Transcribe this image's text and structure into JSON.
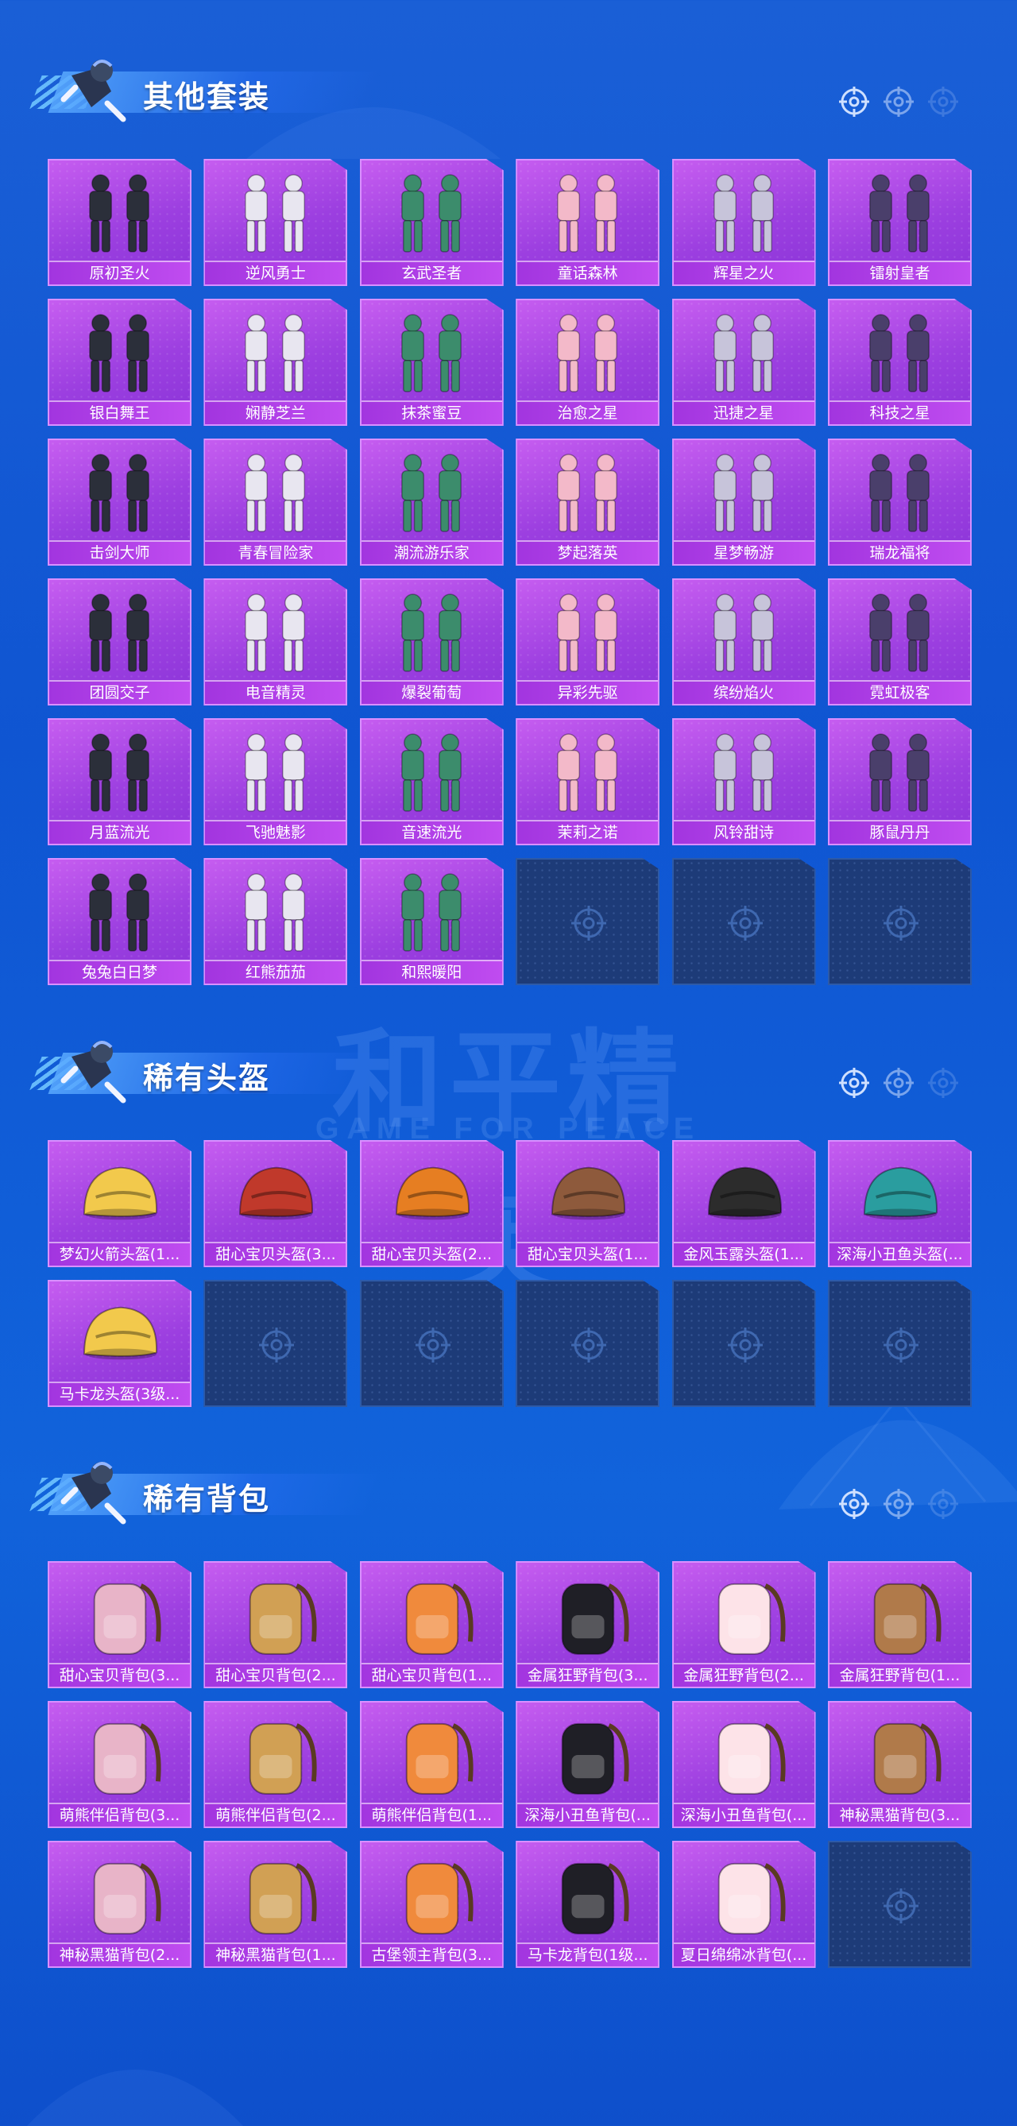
{
  "colors": {
    "background": "#1160d8",
    "card": "#a640e6",
    "label": "#b046ec",
    "empty": "#1d3b78"
  },
  "watermark": {
    "main": "和平精英",
    "sub": "GAME FOR PEACE"
  },
  "sections": [
    {
      "title": "其他套装",
      "icon": "outfit-icon",
      "items": [
        "原初圣火",
        "逆风勇士",
        "玄武圣者",
        "童话森林",
        "辉星之火",
        "镭射皇者",
        "银白舞王",
        "娴静芝兰",
        "抹茶蜜豆",
        "治愈之星",
        "迅捷之星",
        "科技之星",
        "击剑大师",
        "青春冒险家",
        "潮流游乐家",
        "梦起落英",
        "星梦畅游",
        "瑞龙福将",
        "团圆交子",
        "电音精灵",
        "爆裂葡萄",
        "异彩先驱",
        "缤纷焰火",
        "霓虹极客",
        "月蓝流光",
        "飞驰魅影",
        "音速流光",
        "茉莉之诺",
        "风铃甜诗",
        "豚鼠丹丹",
        "兔兔白日梦",
        "红熊茄茄",
        "和熙暖阳"
      ],
      "empty_slots": 3
    },
    {
      "title": "稀有头盔",
      "icon": "helmet-icon",
      "items": [
        "梦幻火箭头盔(1...",
        "甜心宝贝头盔(3...",
        "甜心宝贝头盔(2...",
        "甜心宝贝头盔(1...",
        "金风玉露头盔(1...",
        "深海小丑鱼头盔(...",
        "马卡龙头盔(3级..."
      ],
      "empty_slots": 5
    },
    {
      "title": "稀有背包",
      "icon": "backpack-icon",
      "items": [
        "甜心宝贝背包(3...",
        "甜心宝贝背包(2...",
        "甜心宝贝背包(1...",
        "金属狂野背包(3...",
        "金属狂野背包(2...",
        "金属狂野背包(1...",
        "萌熊伴侣背包(3...",
        "萌熊伴侣背包(2...",
        "萌熊伴侣背包(1...",
        "深海小丑鱼背包(...",
        "深海小丑鱼背包(...",
        "神秘黑猫背包(3...",
        "神秘黑猫背包(2...",
        "神秘黑猫背包(1...",
        "古堡领主背包(3...",
        "马卡龙背包(1级...",
        "夏日绵绵冰背包(..."
      ],
      "empty_slots": 1
    }
  ]
}
